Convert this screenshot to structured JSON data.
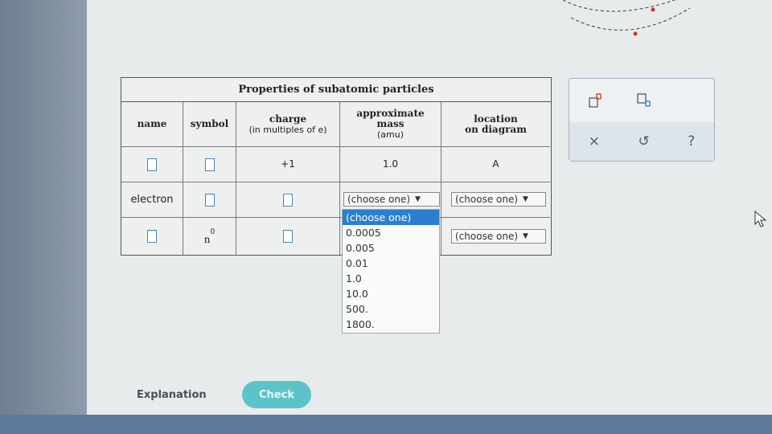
{
  "table": {
    "title": "Properties of subatomic particles",
    "headers": {
      "name": "name",
      "symbol": "symbol",
      "charge": "charge",
      "charge_sub": "(in multiples of e)",
      "mass": "approximate",
      "mass_line2": "mass",
      "mass_sub": "(amu)",
      "location": "location",
      "location_line2": "on diagram"
    },
    "rows": [
      {
        "charge": "+1",
        "mass": "1.0",
        "location": "A"
      },
      {
        "name": "electron",
        "mass_select": "(choose one)",
        "location_select": "(choose one)"
      },
      {
        "symbol_base": "n",
        "symbol_sup": "0",
        "location_select": "(choose one)"
      }
    ]
  },
  "dropdown": {
    "options": [
      "(choose one)",
      "0.0005",
      "0.005",
      "0.01",
      "1.0",
      "10.0",
      "500.",
      "1800."
    ],
    "selected_index": 0
  },
  "tools": {
    "clear_label": "×",
    "undo_label": "↺",
    "help_label": "?"
  },
  "footer": {
    "explanation_label": "Explanation",
    "check_label": "Check"
  },
  "colors": {
    "accent": "#5cc3c9",
    "selected": "#2a7fd0",
    "input_border": "#4d7fb0"
  }
}
